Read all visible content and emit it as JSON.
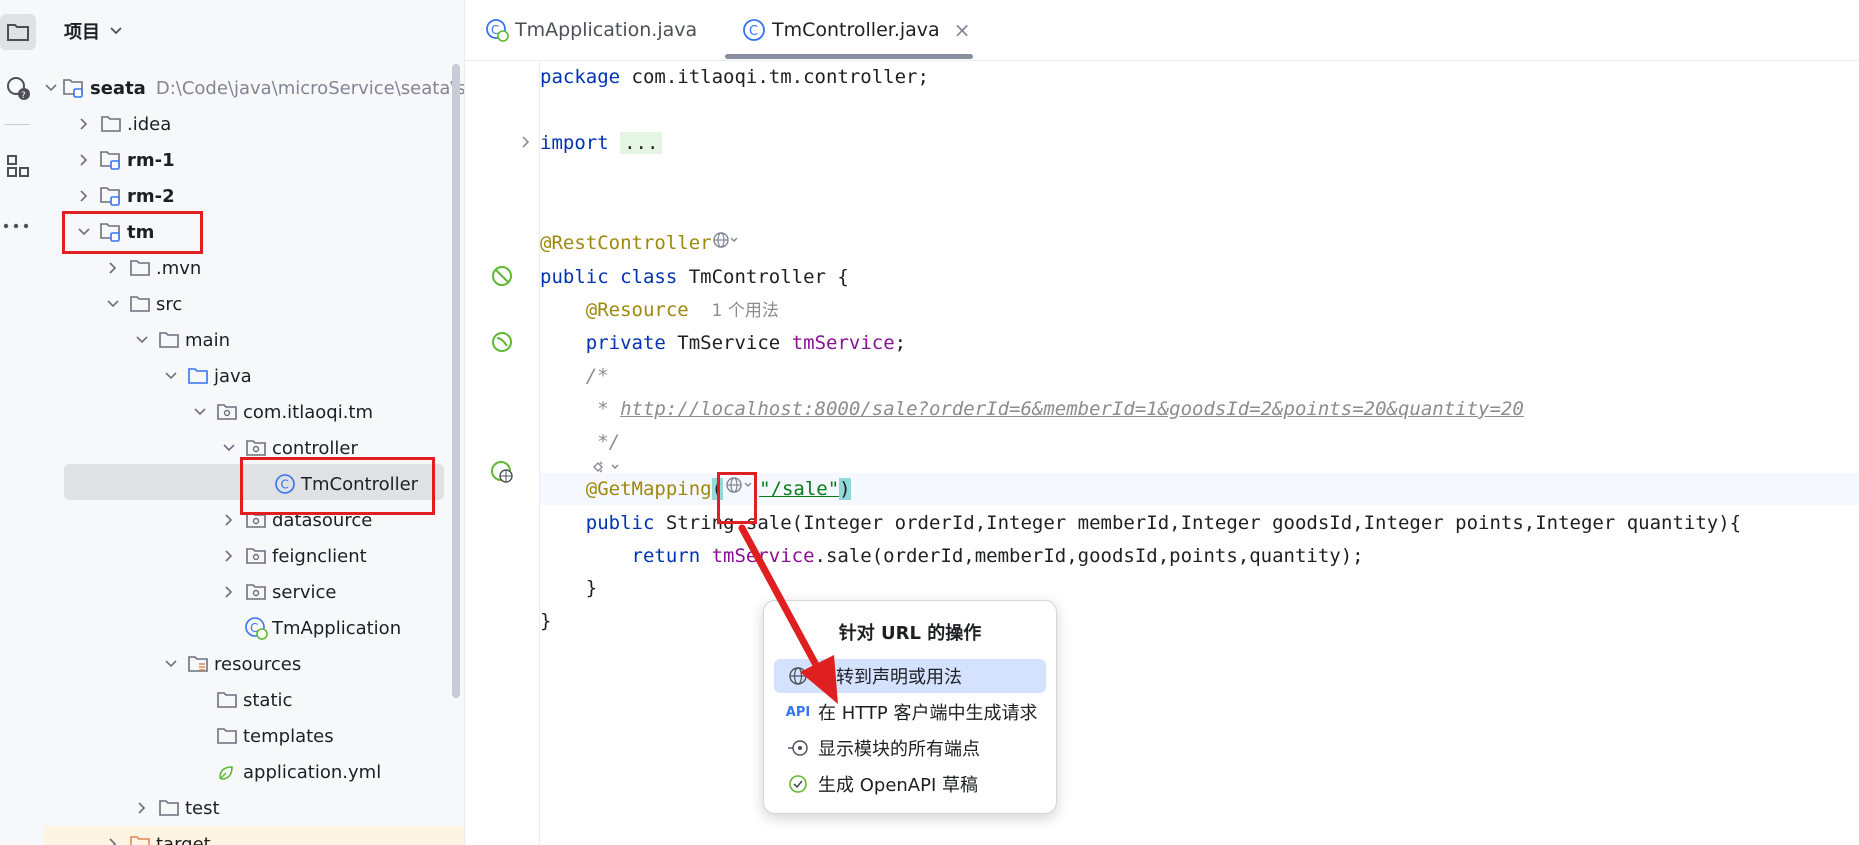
{
  "colors": {
    "accent": "#3574f0",
    "highlight_box": "#e02020",
    "selection": "#dfe1e5",
    "popup_selected": "#d4e2ff"
  },
  "project": {
    "header": "项目",
    "tree": [
      {
        "label": "seata",
        "path": "D:\\Code\\java\\microService\\seata\\sea",
        "bold": true,
        "depth": 0,
        "expanded": true,
        "icon": "module-folder-icon"
      },
      {
        "label": ".idea",
        "depth": 1,
        "expanded": false,
        "icon": "folder-icon"
      },
      {
        "label": "rm-1",
        "bold": true,
        "depth": 1,
        "expanded": false,
        "icon": "module-folder-icon"
      },
      {
        "label": "rm-2",
        "bold": true,
        "depth": 1,
        "expanded": false,
        "icon": "module-folder-icon"
      },
      {
        "label": "tm",
        "bold": true,
        "depth": 1,
        "expanded": true,
        "icon": "module-folder-icon"
      },
      {
        "label": ".mvn",
        "depth": 2,
        "expanded": false,
        "icon": "folder-icon"
      },
      {
        "label": "src",
        "depth": 2,
        "expanded": true,
        "icon": "folder-icon"
      },
      {
        "label": "main",
        "depth": 3,
        "expanded": true,
        "icon": "folder-icon"
      },
      {
        "label": "java",
        "depth": 4,
        "expanded": true,
        "icon": "source-folder-icon"
      },
      {
        "label": "com.itlaoqi.tm",
        "depth": 5,
        "expanded": true,
        "icon": "package-icon"
      },
      {
        "label": "controller",
        "depth": 6,
        "expanded": true,
        "icon": "package-icon"
      },
      {
        "label": "TmController",
        "depth": 7,
        "icon": "class-icon",
        "selected": true
      },
      {
        "label": "datasource",
        "depth": 6,
        "expanded": false,
        "icon": "package-icon"
      },
      {
        "label": "feignclient",
        "depth": 6,
        "expanded": false,
        "icon": "package-icon"
      },
      {
        "label": "service",
        "depth": 6,
        "expanded": false,
        "icon": "package-icon"
      },
      {
        "label": "TmApplication",
        "depth": 6,
        "icon": "spring-class-icon"
      },
      {
        "label": "resources",
        "depth": 4,
        "expanded": true,
        "icon": "resources-folder-icon"
      },
      {
        "label": "static",
        "depth": 5,
        "icon": "folder-icon"
      },
      {
        "label": "templates",
        "depth": 5,
        "icon": "folder-icon"
      },
      {
        "label": "application.yml",
        "depth": 5,
        "icon": "yaml-file-icon"
      },
      {
        "label": "test",
        "depth": 3,
        "expanded": false,
        "icon": "folder-icon"
      },
      {
        "label": "target",
        "depth": 2,
        "expanded": false,
        "icon": "excluded-folder-icon"
      }
    ]
  },
  "tabs": [
    {
      "label": "TmApplication.java",
      "active": false
    },
    {
      "label": "TmController.java",
      "active": true,
      "close": "×"
    }
  ],
  "code": {
    "package_kw": "package",
    "package_name": " com.itlaoqi.tm.controller;",
    "import_kw": "import",
    "import_fold": "...",
    "rest_ann": "@RestController",
    "class_line": {
      "kw1": "public",
      "kw2": " class",
      "rest": " TmController {"
    },
    "resource_ann": "@Resource",
    "resource_hint": "1 个用法",
    "field_line": {
      "kw": "private",
      "type": " TmService ",
      "name": "tmService",
      "end": ";"
    },
    "comment_open": "/*",
    "comment_url_prefix": " * ",
    "comment_url": "http://localhost:8000/sale?orderId=6&memberId=1&goodsId=2&points=20&quantity=20",
    "comment_close": " */",
    "getmapping_ann": "@GetMapping",
    "getmapping_open": "(",
    "getmapping_str": "\"/sale\"",
    "getmapping_close": ")",
    "method_line": {
      "kw": "public",
      "rest": " String sale(Integer orderId,Integer memberId,Integer goodsId,Integer points,Integer quantity){"
    },
    "return_line": {
      "kw": "return",
      "field": " tmService",
      "rest": ".sale(orderId,memberId,goodsId,points,quantity);"
    },
    "brace_inner": "}",
    "brace_outer": "}"
  },
  "popup": {
    "title": "针对 URL 的操作",
    "items": [
      {
        "label": "跳转到声明或用法",
        "icon": "globe-icon"
      },
      {
        "label": "在 HTTP 客户端中生成请求",
        "icon": "api-icon",
        "icon_text": "API"
      },
      {
        "label": "显示模块的所有端点",
        "icon": "endpoint-icon"
      },
      {
        "label": "生成 OpenAPI 草稿",
        "icon": "openapi-icon"
      }
    ]
  }
}
